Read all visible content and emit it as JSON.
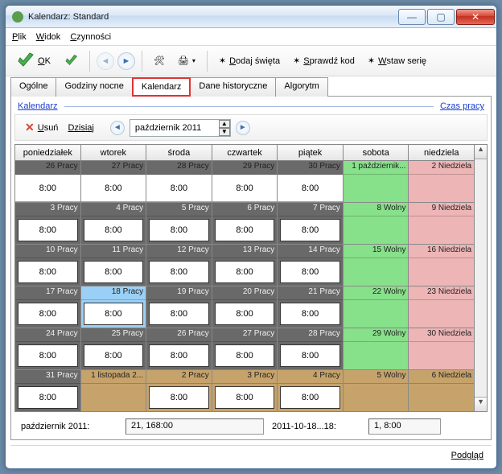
{
  "window": {
    "title": "Kalendarz: Standard"
  },
  "menu": {
    "items": [
      "Plik",
      "Widok",
      "Czynności"
    ]
  },
  "toolbar": {
    "ok_label": "OK",
    "dodaj_swieta": "Dodaj święta",
    "sprawdz_kod": "Sprawdź kod",
    "wstaw_serie": "Wstaw serię"
  },
  "tabs": {
    "items": [
      {
        "label": "Ogólne"
      },
      {
        "label": "Godziny nocne"
      },
      {
        "label": "Kalendarz"
      },
      {
        "label": "Dane historyczne"
      },
      {
        "label": "Algorytm"
      }
    ],
    "active": 2
  },
  "section": {
    "title": "Kalendarz",
    "right_link": "Czas pracy"
  },
  "subtoolbar": {
    "usun": "Usuń",
    "dzisiaj": "Dzisiaj",
    "month": "październik 2011"
  },
  "headers": [
    "poniedziałek",
    "wtorek",
    "środa",
    "czwartek",
    "piątek",
    "sobota",
    "niedziela"
  ],
  "rows": [
    [
      {
        "hdr": "26 Pracy",
        "val": "8:00",
        "cls": "bg-tan c-prev"
      },
      {
        "hdr": "27 Pracy",
        "val": "8:00",
        "cls": "bg-tan c-prev"
      },
      {
        "hdr": "28 Pracy",
        "val": "8:00",
        "cls": "bg-tan c-prev"
      },
      {
        "hdr": "29 Pracy",
        "val": "8:00",
        "cls": "bg-tan c-prev"
      },
      {
        "hdr": "30 Pracy",
        "val": "8:00",
        "cls": "bg-tan c-prev"
      },
      {
        "hdr": "1 październik...",
        "val": "",
        "cls": "bg-green"
      },
      {
        "hdr": "2 Niedziela",
        "val": "",
        "cls": "bg-pink"
      }
    ],
    [
      {
        "hdr": "3 Pracy",
        "val": "8:00",
        "cls": "bg-gray"
      },
      {
        "hdr": "4 Pracy",
        "val": "8:00",
        "cls": "bg-gray"
      },
      {
        "hdr": "5 Pracy",
        "val": "8:00",
        "cls": "bg-gray"
      },
      {
        "hdr": "6 Pracy",
        "val": "8:00",
        "cls": "bg-gray"
      },
      {
        "hdr": "7 Pracy",
        "val": "8:00",
        "cls": "bg-gray"
      },
      {
        "hdr": "8 Wolny",
        "val": "",
        "cls": "bg-green"
      },
      {
        "hdr": "9 Niedziela",
        "val": "",
        "cls": "bg-pink"
      }
    ],
    [
      {
        "hdr": "10 Pracy",
        "val": "8:00",
        "cls": "bg-gray"
      },
      {
        "hdr": "11 Pracy",
        "val": "8:00",
        "cls": "bg-gray"
      },
      {
        "hdr": "12 Pracy",
        "val": "8:00",
        "cls": "bg-gray"
      },
      {
        "hdr": "13 Pracy",
        "val": "8:00",
        "cls": "bg-gray"
      },
      {
        "hdr": "14 Pracy",
        "val": "8:00",
        "cls": "bg-gray"
      },
      {
        "hdr": "15 Wolny",
        "val": "",
        "cls": "bg-green"
      },
      {
        "hdr": "16 Niedziela",
        "val": "",
        "cls": "bg-pink"
      }
    ],
    [
      {
        "hdr": "17 Pracy",
        "val": "8:00",
        "cls": "bg-gray"
      },
      {
        "hdr": "18 Pracy",
        "val": "8:00",
        "cls": "bg-sel"
      },
      {
        "hdr": "19 Pracy",
        "val": "8:00",
        "cls": "bg-gray"
      },
      {
        "hdr": "20 Pracy",
        "val": "8:00",
        "cls": "bg-gray"
      },
      {
        "hdr": "21 Pracy",
        "val": "8:00",
        "cls": "bg-gray"
      },
      {
        "hdr": "22 Wolny",
        "val": "",
        "cls": "bg-green"
      },
      {
        "hdr": "23 Niedziela",
        "val": "",
        "cls": "bg-pink"
      }
    ],
    [
      {
        "hdr": "24 Pracy",
        "val": "8:00",
        "cls": "bg-gray"
      },
      {
        "hdr": "25 Pracy",
        "val": "8:00",
        "cls": "bg-gray"
      },
      {
        "hdr": "26 Pracy",
        "val": "8:00",
        "cls": "bg-gray"
      },
      {
        "hdr": "27 Pracy",
        "val": "8:00",
        "cls": "bg-gray"
      },
      {
        "hdr": "28 Pracy",
        "val": "8:00",
        "cls": "bg-gray"
      },
      {
        "hdr": "29 Wolny",
        "val": "",
        "cls": "bg-green"
      },
      {
        "hdr": "30 Niedziela",
        "val": "",
        "cls": "bg-pink"
      }
    ],
    [
      {
        "hdr": "31 Pracy",
        "val": "8:00",
        "cls": "bg-gray"
      },
      {
        "hdr": "1 listopada 2...",
        "val": "",
        "cls": "bg-tan"
      },
      {
        "hdr": "2 Pracy",
        "val": "8:00",
        "cls": "bg-tan"
      },
      {
        "hdr": "3 Pracy",
        "val": "8:00",
        "cls": "bg-tan"
      },
      {
        "hdr": "4 Pracy",
        "val": "8:00",
        "cls": "bg-tan"
      },
      {
        "hdr": "5 Wolny",
        "val": "",
        "cls": "bg-tan"
      },
      {
        "hdr": "6 Niedziela",
        "val": "",
        "cls": "bg-tan"
      }
    ]
  ],
  "status": {
    "l1": "październik 2011:",
    "v1": "21, 168:00",
    "l2": "2011-10-18...18:",
    "v2": "1, 8:00"
  },
  "footer": {
    "podglad": "Podgląd"
  }
}
